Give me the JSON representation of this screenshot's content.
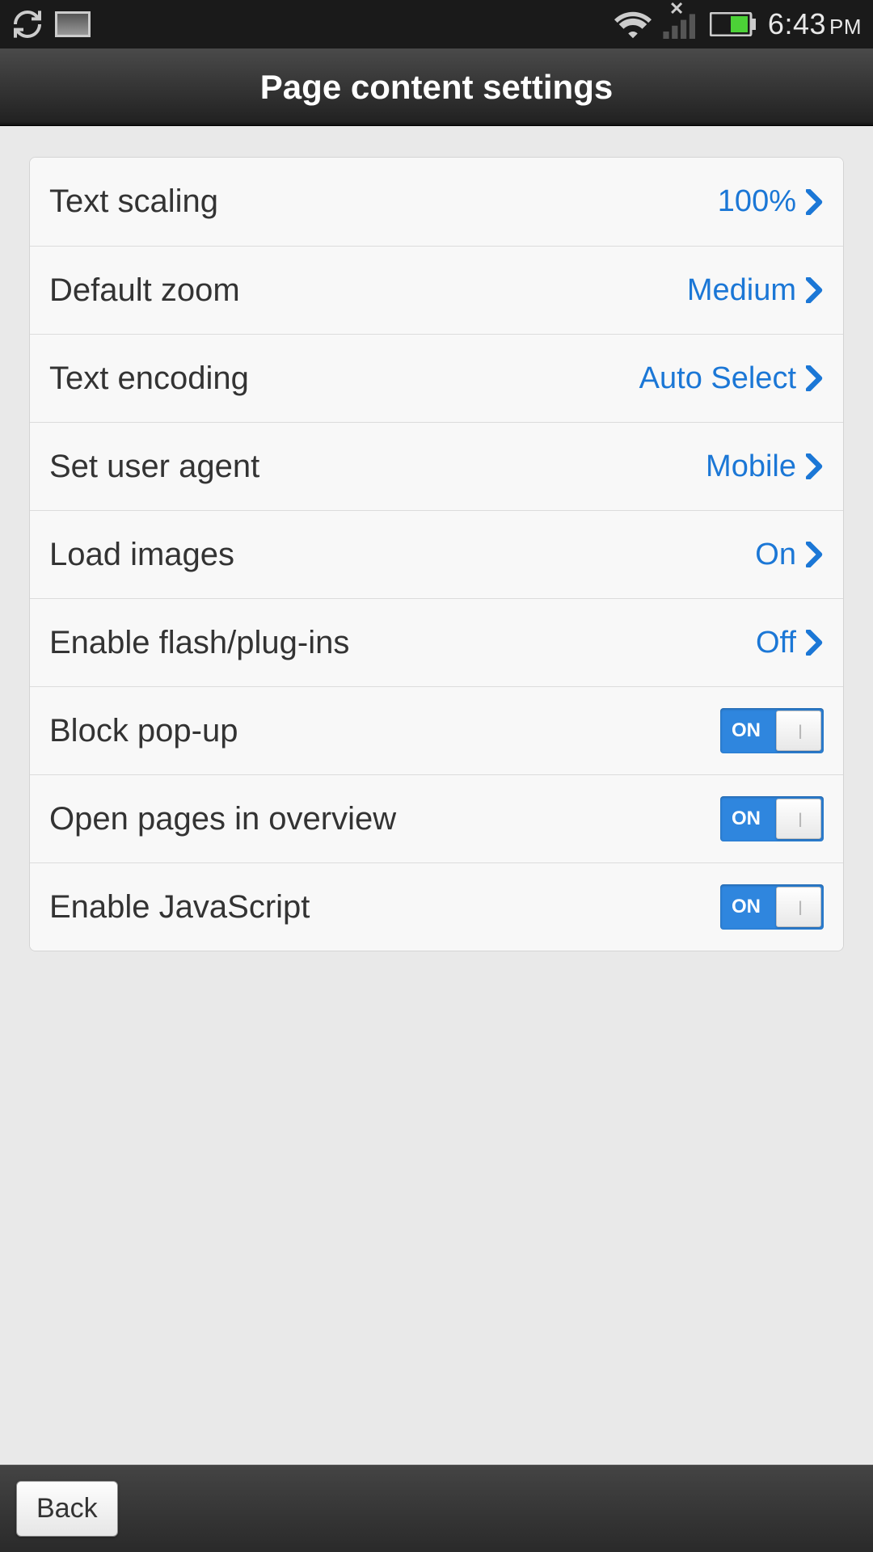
{
  "status": {
    "time": "6:43",
    "ampm": "PM"
  },
  "header": {
    "title": "Page content settings"
  },
  "rows": {
    "text_scaling": {
      "label": "Text scaling",
      "value": "100%"
    },
    "default_zoom": {
      "label": "Default zoom",
      "value": "Medium"
    },
    "text_encoding": {
      "label": "Text encoding",
      "value": "Auto Select"
    },
    "user_agent": {
      "label": "Set user agent",
      "value": "Mobile"
    },
    "load_images": {
      "label": "Load images",
      "value": "On"
    },
    "flash": {
      "label": "Enable flash/plug-ins",
      "value": "Off"
    },
    "block_popup": {
      "label": "Block pop-up",
      "toggle": "ON"
    },
    "overview": {
      "label": "Open pages in overview",
      "toggle": "ON"
    },
    "javascript": {
      "label": "Enable JavaScript",
      "toggle": "ON"
    }
  },
  "footer": {
    "back": "Back"
  }
}
